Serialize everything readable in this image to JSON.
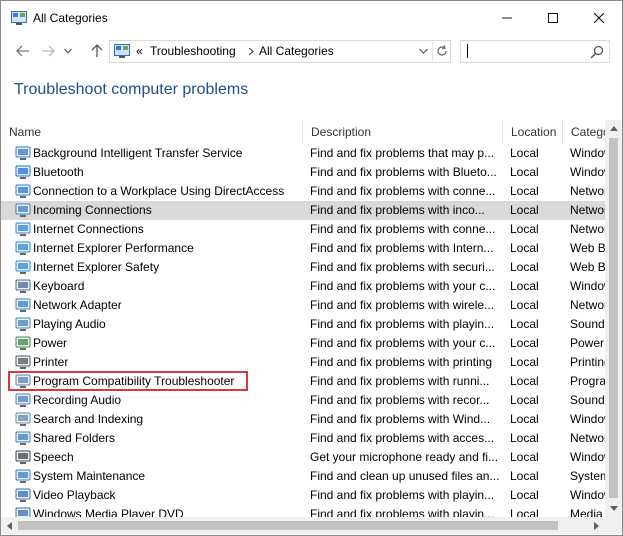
{
  "window": {
    "title": "All Categories"
  },
  "address": {
    "separator": "«",
    "segments": [
      "Troubleshooting",
      "All Categories"
    ]
  },
  "search": {
    "placeholder": ""
  },
  "page_title": "Troubleshoot computer problems",
  "columns": [
    "Name",
    "Description",
    "Location",
    "Category"
  ],
  "rows": [
    {
      "name": "Background Intelligent Transfer Service",
      "desc": "Find and fix problems that may p...",
      "loc": "Local",
      "cat": "Windows",
      "icon": "bits-icon",
      "color": "#3a78c8"
    },
    {
      "name": "Bluetooth",
      "desc": "Find and fix problems with Blueto...",
      "loc": "Local",
      "cat": "Windows",
      "icon": "bluetooth-icon",
      "color": "#1f6fd6"
    },
    {
      "name": "Connection to a Workplace Using DirectAccess",
      "desc": "Find and fix problems with conne...",
      "loc": "Local",
      "cat": "Network",
      "icon": "directaccess-icon",
      "color": "#2d7ad0"
    },
    {
      "name": "Incoming Connections",
      "desc": "Find and fix problems with inco...",
      "loc": "Local",
      "cat": "Network",
      "icon": "incoming-connections-icon",
      "color": "#3f7fb8"
    },
    {
      "name": "Internet Connections",
      "desc": "Find and fix problems with conne...",
      "loc": "Local",
      "cat": "Network",
      "icon": "internet-connections-icon",
      "color": "#2e88d8"
    },
    {
      "name": "Internet Explorer Performance",
      "desc": "Find and fix problems with Intern...",
      "loc": "Local",
      "cat": "Web Browser",
      "icon": "ie-performance-icon",
      "color": "#2e88d8"
    },
    {
      "name": "Internet Explorer Safety",
      "desc": "Find and fix problems with securi...",
      "loc": "Local",
      "cat": "Web Browser",
      "icon": "ie-safety-icon",
      "color": "#2e88d8"
    },
    {
      "name": "Keyboard",
      "desc": "Find and fix problems with your c...",
      "loc": "Local",
      "cat": "Windows",
      "icon": "keyboard-icon",
      "color": "#4c6a8c"
    },
    {
      "name": "Network Adapter",
      "desc": "Find and fix problems with wirele...",
      "loc": "Local",
      "cat": "Network",
      "icon": "network-adapter-icon",
      "color": "#3a7fbf"
    },
    {
      "name": "Playing Audio",
      "desc": "Find and fix problems with playin...",
      "loc": "Local",
      "cat": "Sound",
      "icon": "playing-audio-icon",
      "color": "#4a82b8"
    },
    {
      "name": "Power",
      "desc": "Find and fix problems with your c...",
      "loc": "Local",
      "cat": "Power",
      "icon": "power-icon",
      "color": "#3c8a3c"
    },
    {
      "name": "Printer",
      "desc": "Find and fix problems with printing",
      "loc": "Local",
      "cat": "Printing",
      "icon": "printer-icon",
      "color": "#555555"
    },
    {
      "name": "Program Compatibility Troubleshooter",
      "desc": "Find and fix problems with runni...",
      "loc": "Local",
      "cat": "Programs",
      "icon": "program-compatibility-icon",
      "color": "#5a7fa8"
    },
    {
      "name": "Recording Audio",
      "desc": "Find and fix problems with recor...",
      "loc": "Local",
      "cat": "Sound",
      "icon": "recording-audio-icon",
      "color": "#4a82b8"
    },
    {
      "name": "Search and Indexing",
      "desc": "Find and fix problems with Wind...",
      "loc": "Local",
      "cat": "Windows",
      "icon": "search-indexing-icon",
      "color": "#6a8aa8"
    },
    {
      "name": "Shared Folders",
      "desc": "Find and fix problems with acces...",
      "loc": "Local",
      "cat": "Network",
      "icon": "shared-folders-icon",
      "color": "#3a7fbf"
    },
    {
      "name": "Speech",
      "desc": "Get your microphone ready and fi...",
      "loc": "Local",
      "cat": "Windows",
      "icon": "speech-icon",
      "color": "#444444"
    },
    {
      "name": "System Maintenance",
      "desc": "Find and clean up unused files an...",
      "loc": "Local",
      "cat": "System",
      "icon": "system-maintenance-icon",
      "color": "#3a7fbf"
    },
    {
      "name": "Video Playback",
      "desc": "Find and fix problems with playin...",
      "loc": "Local",
      "cat": "Windows",
      "icon": "video-playback-icon",
      "color": "#3a6fb0"
    },
    {
      "name": "Windows Media Player DVD",
      "desc": "Find and fix problems with playin...",
      "loc": "Local",
      "cat": "Media",
      "icon": "media-player-dvd-icon",
      "color": "#3a6fb0"
    }
  ],
  "selected_row": 3,
  "highlighted_row": 12,
  "colors": {
    "accent_title": "#1e4e8c",
    "selection": "#d9d9d9",
    "highlight_border": "#d9373b"
  }
}
